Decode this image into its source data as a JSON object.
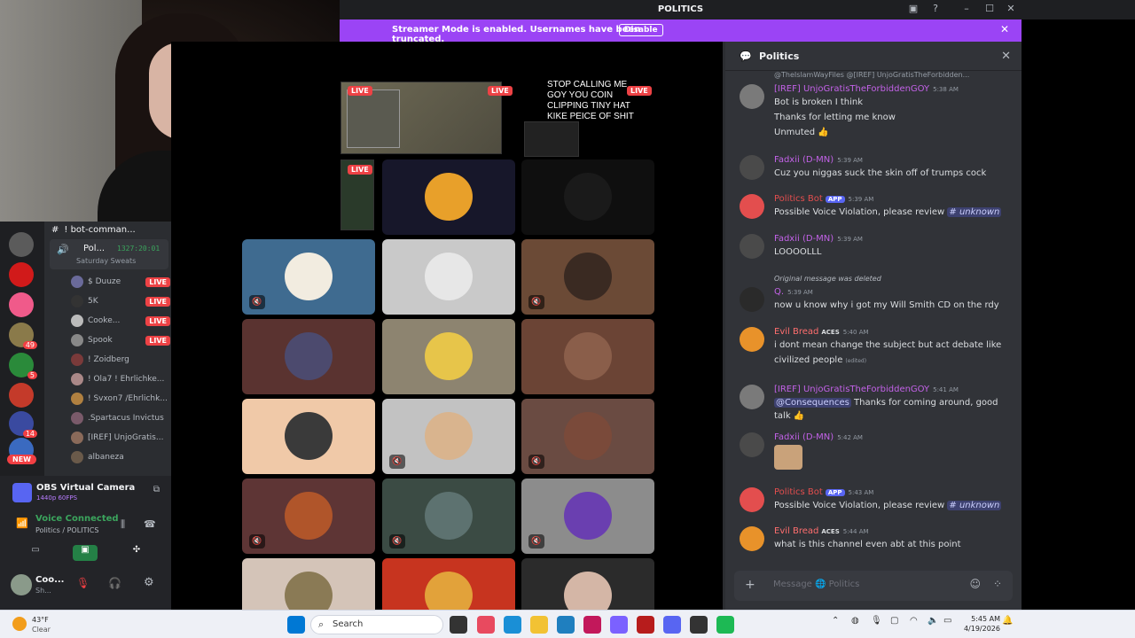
{
  "window": {
    "title": "POLITICS",
    "banner_text": "Streamer Mode is enabled. Usernames have been truncated.",
    "banner_button": "Disable"
  },
  "left_panel": {
    "channel_header": "! bot-comman...",
    "voice_channel": {
      "name": "Pol...",
      "timer": "1327:20:01",
      "status": "Saturday Sweats"
    },
    "members": [
      {
        "name": "$ Duuze",
        "live": true
      },
      {
        "name": "5K",
        "live": true
      },
      {
        "name": "Cooke...",
        "live": true
      },
      {
        "name": "Spook",
        "live": true
      },
      {
        "name": "! Zoidberg",
        "live": false
      },
      {
        "name": "! Ola7 ! Ehrlichke...",
        "live": false
      },
      {
        "name": "! Svxon7 /Ehrlichk...",
        "live": false
      },
      {
        "name": ".Spartacus Invictus",
        "live": false
      },
      {
        "name": "[IREF] UnjoGratis...",
        "live": false
      },
      {
        "name": "albaneza",
        "live": false
      }
    ],
    "live_label": "LIVE",
    "server_badges": [
      "49",
      "5",
      "14"
    ],
    "new_label": "NEW",
    "obs": {
      "title": "OBS Virtual Camera",
      "sub": "1440p 60FPS"
    },
    "voice": {
      "status": "Voice Connected",
      "channel": "Politics / POLITICS"
    },
    "user": {
      "name": "Coo...",
      "status": "Sh..."
    }
  },
  "stage": {
    "live_label": "LIVE",
    "meme_text": "STOP CALLING ME GOY YOU COIN CLIPPING TINY HAT KIKE PEICE OF SHIT",
    "tiles": [
      {
        "color": "#3f6b90",
        "avatar": "#f2ece0",
        "muted": true
      },
      {
        "color": "#c9c9c9",
        "avatar": "#e7e7e7",
        "muted": false
      },
      {
        "color": "#6b4a36",
        "avatar": "#3a2a22",
        "muted": true
      },
      {
        "color": "#5a3330",
        "avatar": "#4c4a6e",
        "muted": false
      },
      {
        "color": "#8d8470",
        "avatar": "#e7c54a",
        "muted": false
      },
      {
        "color": "#6b4435",
        "avatar": "#8a5e4a",
        "muted": false
      },
      {
        "color": "#f0c9a8",
        "avatar": "#3a3a3a",
        "muted": false
      },
      {
        "color": "#c2c2c2",
        "avatar": "#d9b48e",
        "muted": true
      },
      {
        "color": "#6a4b42",
        "avatar": "#7a4a3a",
        "muted": true
      },
      {
        "color": "#5e3535",
        "avatar": "#b0552a",
        "muted": true
      },
      {
        "color": "#3b4b44",
        "avatar": "#5d7270",
        "muted": true
      },
      {
        "color": "#8c8c8c",
        "avatar": "#6a3fb0",
        "muted": true
      },
      {
        "color": "#d4c4b8",
        "avatar": "#8a7a55",
        "muted": false
      },
      {
        "color": "#c7341f",
        "avatar": "#e2a23a",
        "muted": false
      },
      {
        "color": "#2b2b2b",
        "avatar": "#d4b6a6",
        "muted": false
      }
    ]
  },
  "chat": {
    "title": "Politics",
    "reply_preview": "@TheIslamWayFiles @[IREF] UnjoGratisTheForbidden...",
    "messages": [
      {
        "name": "[IREF] UnjoGratisTheForbiddenGOY",
        "color": "#c362e8",
        "time": "5:38 AM",
        "lines": [
          "Bot is broken I think",
          "Thanks for letting me know",
          "Unmuted 👍"
        ]
      },
      {
        "name": "Fadxii (D-MN)",
        "color": "#c362e8",
        "time": "5:39 AM",
        "lines": [
          "Cuz you niggas suck the skin off of trumps cock"
        ]
      },
      {
        "name": "Politics Bot",
        "color": "#e34e4e",
        "time": "5:39 AM",
        "app": "APP",
        "lines": [
          "Possible Voice Violation, please review"
        ],
        "channel": "# unknown"
      },
      {
        "name": "Fadxii (D-MN)",
        "color": "#c362e8",
        "time": "5:39 AM",
        "lines": [
          "LOOOOLLL"
        ]
      },
      {
        "name": "Q.",
        "color": "#c362e8",
        "time": "5:39 AM",
        "deleted": "Original message was deleted",
        "lines": [
          "now u know why i got my Will Smith CD on the rdy"
        ]
      },
      {
        "name": "Evil Bread",
        "color": "#ff6e6e",
        "time": "5:40 AM",
        "tag": "ACES",
        "lines": [
          "i dont mean change the subject but act debate  like",
          "civilized people"
        ],
        "edited": "(edited)"
      },
      {
        "name": "[IREF] UnjoGratisTheForbiddenGOY",
        "color": "#c362e8",
        "time": "5:41 AM",
        "mention": "@Consequences",
        "lines": [
          "Thanks for coming around, good",
          "talk 👍"
        ]
      },
      {
        "name": "Fadxii (D-MN)",
        "color": "#c362e8",
        "time": "5:42 AM",
        "lines": []
      },
      {
        "name": "Politics Bot",
        "color": "#e34e4e",
        "time": "5:43 AM",
        "app": "APP",
        "lines": [
          "Possible Voice Violation, please review"
        ],
        "channel": "# unknown"
      },
      {
        "name": "Evil Bread",
        "color": "#ff6e6e",
        "time": "5:44 AM",
        "tag": "ACES",
        "lines": [
          "what is this channel even abt at this point"
        ]
      }
    ],
    "composer_placeholder": "Message 🌐 Politics"
  },
  "taskbar": {
    "weather_temp": "43°F",
    "weather_desc": "Clear",
    "search": "Search",
    "time": "5:45 AM",
    "date": "4/19/2026"
  }
}
